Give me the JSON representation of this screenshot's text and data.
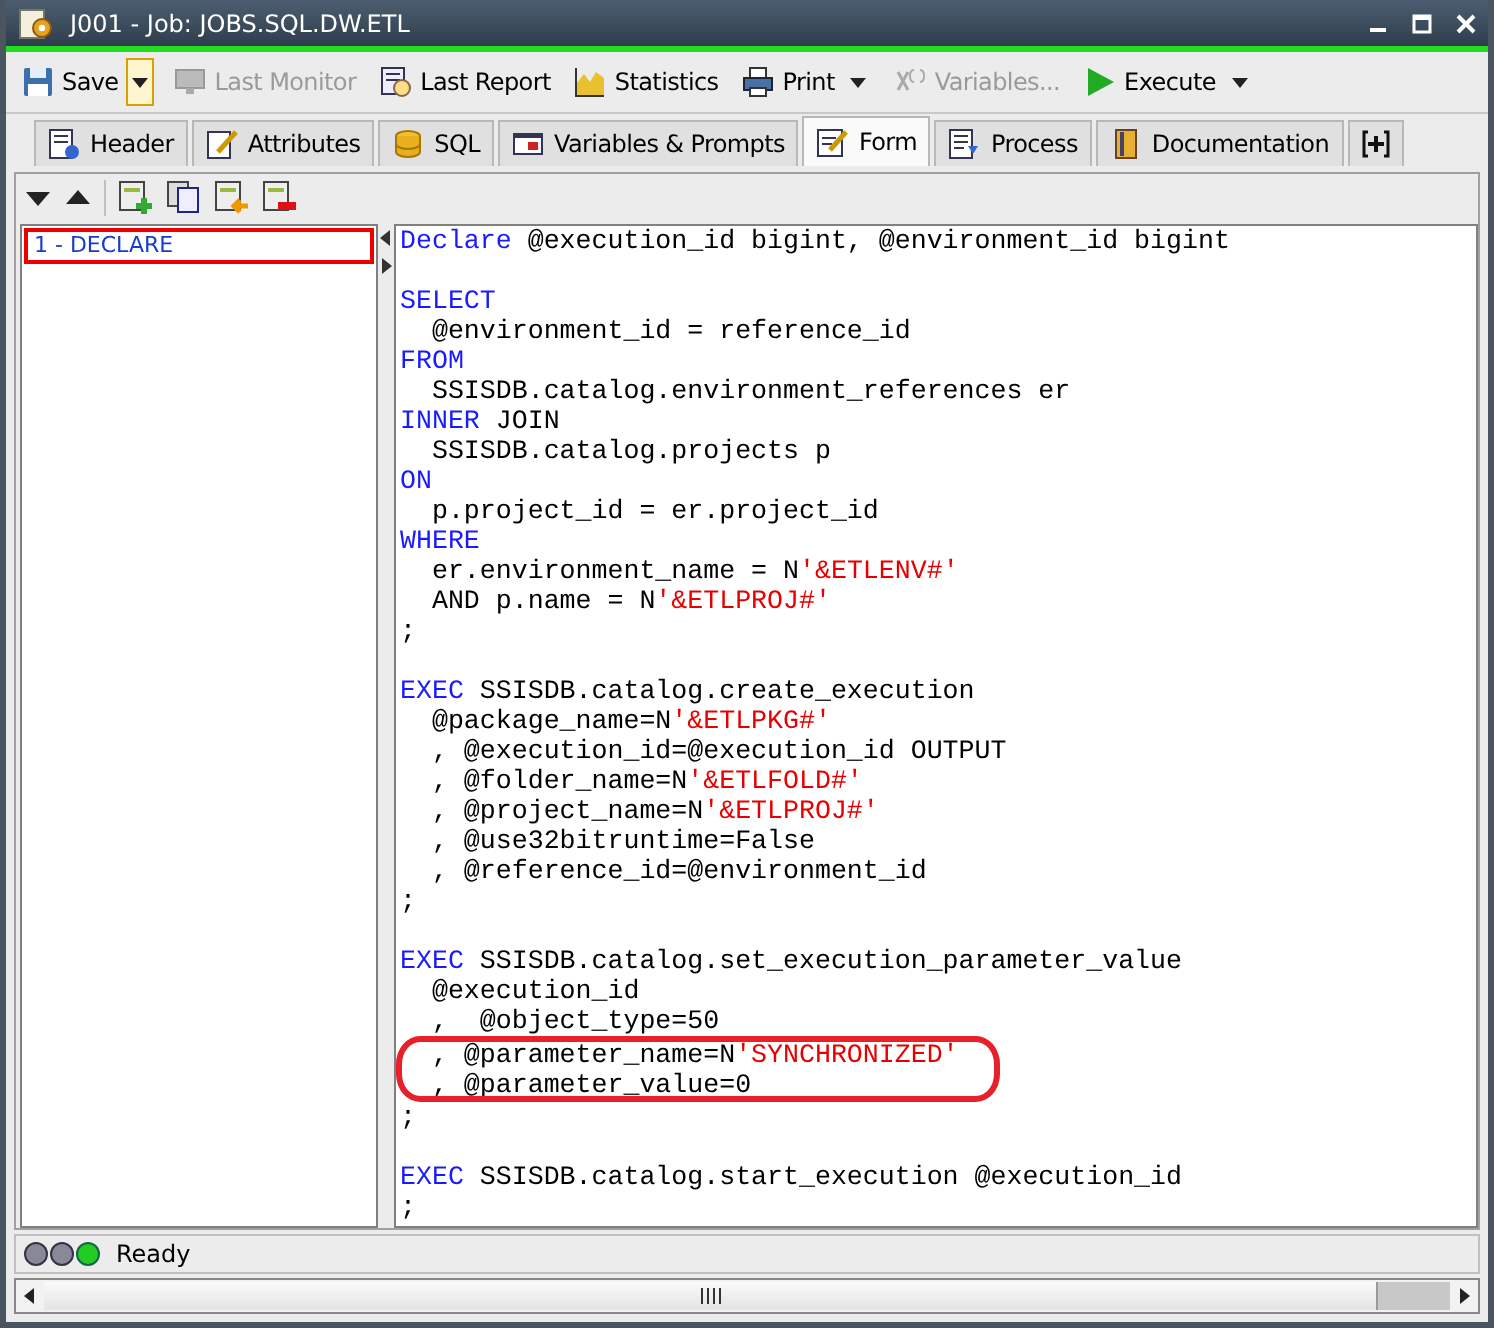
{
  "window": {
    "title": "J001 - Job: JOBS.SQL.DW.ETL"
  },
  "toolbar": [
    {
      "label": "Save",
      "disabled": false,
      "dropdown": {
        "focused": true
      }
    },
    {
      "label": "Last Monitor",
      "disabled": true
    },
    {
      "label": "Last Report",
      "disabled": false
    },
    {
      "label": "Statistics",
      "disabled": false
    },
    {
      "label": "Print",
      "disabled": false,
      "dropdown": {
        "focused": false
      }
    },
    {
      "label": "Variables...",
      "disabled": true
    },
    {
      "label": "Execute",
      "disabled": false,
      "dropdown": {
        "focused": false
      }
    }
  ],
  "tabs": [
    {
      "label": "Header",
      "selected": false
    },
    {
      "label": "Attributes",
      "selected": false
    },
    {
      "label": "SQL",
      "selected": false
    },
    {
      "label": "Variables & Prompts",
      "selected": false
    },
    {
      "label": "Form",
      "selected": true
    },
    {
      "label": "Process",
      "selected": false
    },
    {
      "label": "Documentation",
      "selected": false
    }
  ],
  "steps": [
    {
      "label": "1 - DECLARE",
      "selected": true
    }
  ],
  "code": [
    {
      "kind": "code",
      "highlighted": false,
      "parts": [
        {
          "kind": "keyword",
          "text": "Declare"
        },
        {
          "kind": "plain",
          "text": " @execution_id bigint, @environment_id bigint"
        }
      ]
    },
    {
      "kind": "blank"
    },
    {
      "kind": "code",
      "highlighted": false,
      "parts": [
        {
          "kind": "keyword",
          "text": "SELECT"
        }
      ]
    },
    {
      "kind": "code",
      "highlighted": false,
      "parts": [
        {
          "kind": "plain",
          "text": "  @environment_id = reference_id"
        }
      ]
    },
    {
      "kind": "code",
      "highlighted": false,
      "parts": [
        {
          "kind": "keyword",
          "text": "FROM"
        }
      ]
    },
    {
      "kind": "code",
      "highlighted": false,
      "parts": [
        {
          "kind": "plain",
          "text": "  SSISDB.catalog.environment_references er"
        }
      ]
    },
    {
      "kind": "code",
      "highlighted": false,
      "parts": [
        {
          "kind": "keyword",
          "text": "INNER"
        },
        {
          "kind": "plain",
          "text": " JOIN"
        }
      ]
    },
    {
      "kind": "code",
      "highlighted": false,
      "parts": [
        {
          "kind": "plain",
          "text": "  SSISDB.catalog.projects p"
        }
      ]
    },
    {
      "kind": "code",
      "highlighted": false,
      "parts": [
        {
          "kind": "keyword",
          "text": "ON"
        }
      ]
    },
    {
      "kind": "code",
      "highlighted": false,
      "parts": [
        {
          "kind": "plain",
          "text": "  p.project_id = er.project_id"
        }
      ]
    },
    {
      "kind": "code",
      "highlighted": false,
      "parts": [
        {
          "kind": "keyword",
          "text": "WHERE"
        }
      ]
    },
    {
      "kind": "code",
      "highlighted": false,
      "parts": [
        {
          "kind": "plain",
          "text": "  er.environment_name = N"
        },
        {
          "kind": "string",
          "text": "'&ETLENV#'"
        }
      ]
    },
    {
      "kind": "code",
      "highlighted": false,
      "parts": [
        {
          "kind": "plain",
          "text": "  AND p.name = N"
        },
        {
          "kind": "string",
          "text": "'&ETLPROJ#'"
        }
      ]
    },
    {
      "kind": "code",
      "highlighted": false,
      "parts": [
        {
          "kind": "plain",
          "text": ";"
        }
      ]
    },
    {
      "kind": "blank"
    },
    {
      "kind": "code",
      "highlighted": false,
      "parts": [
        {
          "kind": "keyword",
          "text": "EXEC"
        },
        {
          "kind": "plain",
          "text": " SSISDB.catalog.create_execution"
        }
      ]
    },
    {
      "kind": "code",
      "highlighted": false,
      "parts": [
        {
          "kind": "plain",
          "text": "  @package_name=N"
        },
        {
          "kind": "string",
          "text": "'&ETLPKG#'"
        }
      ]
    },
    {
      "kind": "code",
      "highlighted": false,
      "parts": [
        {
          "kind": "plain",
          "text": "  , @execution_id=@execution_id OUTPUT"
        }
      ]
    },
    {
      "kind": "code",
      "highlighted": false,
      "parts": [
        {
          "kind": "plain",
          "text": "  , @folder_name=N"
        },
        {
          "kind": "string",
          "text": "'&ETLFOLD#'"
        }
      ]
    },
    {
      "kind": "code",
      "highlighted": false,
      "parts": [
        {
          "kind": "plain",
          "text": "  , @project_name=N"
        },
        {
          "kind": "string",
          "text": "'&ETLPROJ#'"
        }
      ]
    },
    {
      "kind": "code",
      "highlighted": false,
      "parts": [
        {
          "kind": "plain",
          "text": "  , @use32bitruntime=False"
        }
      ]
    },
    {
      "kind": "code",
      "highlighted": false,
      "parts": [
        {
          "kind": "plain",
          "text": "  , @reference_id=@environment_id"
        }
      ]
    },
    {
      "kind": "code",
      "highlighted": false,
      "parts": [
        {
          "kind": "plain",
          "text": ";"
        }
      ]
    },
    {
      "kind": "blank"
    },
    {
      "kind": "code",
      "highlighted": false,
      "parts": [
        {
          "kind": "keyword",
          "text": "EXEC"
        },
        {
          "kind": "plain",
          "text": " SSISDB.catalog.set_execution_parameter_value"
        }
      ]
    },
    {
      "kind": "code",
      "highlighted": false,
      "parts": [
        {
          "kind": "plain",
          "text": "  @execution_id"
        }
      ]
    },
    {
      "kind": "code",
      "highlighted": false,
      "parts": [
        {
          "kind": "plain",
          "text": "  ,  @object_type=50"
        }
      ]
    },
    {
      "kind": "code",
      "highlighted": true,
      "parts": [
        {
          "kind": "plain",
          "text": "  , @parameter_name=N"
        },
        {
          "kind": "string",
          "text": "'SYNCHRONIZED'"
        }
      ]
    },
    {
      "kind": "code",
      "highlighted": true,
      "parts": [
        {
          "kind": "plain",
          "text": "  , @parameter_value=0"
        }
      ]
    },
    {
      "kind": "code",
      "highlighted": false,
      "parts": [
        {
          "kind": "plain",
          "text": ";"
        }
      ]
    },
    {
      "kind": "blank"
    },
    {
      "kind": "code",
      "highlighted": false,
      "parts": [
        {
          "kind": "keyword",
          "text": "EXEC"
        },
        {
          "kind": "plain",
          "text": " SSISDB.catalog.start_execution @execution_id"
        }
      ]
    },
    {
      "kind": "code",
      "highlighted": false,
      "parts": [
        {
          "kind": "plain",
          "text": ";"
        }
      ]
    }
  ],
  "status_bar": {
    "text": "Ready"
  }
}
